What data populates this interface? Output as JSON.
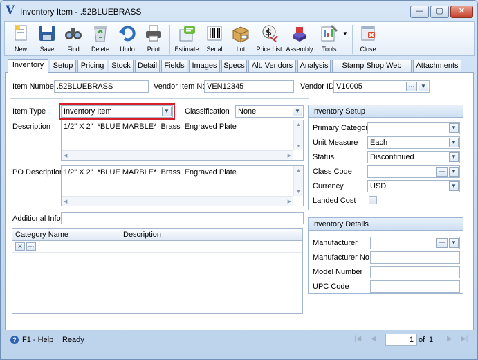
{
  "window": {
    "logo": "V",
    "title": "Inventory Item - .52BLUEBRASS",
    "controls": {
      "minimize": "—",
      "maximize": "▢",
      "close": "✕"
    }
  },
  "toolbar": {
    "buttons": [
      {
        "label": "New",
        "icon": "new-doc-icon"
      },
      {
        "label": "Save",
        "icon": "floppy-disk-icon"
      },
      {
        "label": "Find",
        "icon": "binoculars-icon"
      },
      {
        "label": "Delete",
        "icon": "recycle-bin-icon"
      },
      {
        "label": "Undo",
        "icon": "undo-arrow-icon"
      },
      {
        "label": "Print",
        "icon": "printer-icon"
      },
      {
        "label": "Estimate",
        "icon": "estimate-icon"
      },
      {
        "label": "Serial",
        "icon": "barcode-icon"
      },
      {
        "label": "Lot",
        "icon": "lot-box-icon"
      },
      {
        "label": "Price List",
        "icon": "price-list-icon"
      },
      {
        "label": "Assembly",
        "icon": "assembly-blocks-icon"
      },
      {
        "label": "Tools",
        "icon": "tools-icon"
      },
      {
        "label": "Close",
        "icon": "close-door-icon"
      }
    ]
  },
  "tabs": [
    "Inventory",
    "Setup",
    "Pricing",
    "Stock",
    "Detail",
    "Fields",
    "Images",
    "Specs",
    "Alt. Vendors",
    "Analysis",
    "Stamp Shop Web Detail",
    "Attachments"
  ],
  "header": {
    "item_number_label": "Item Number",
    "item_number": ".52BLUEBRASS",
    "vendor_item_label": "Vendor Item No",
    "vendor_item": "VEN12345",
    "vendor_id_label": "Vendor ID",
    "vendor_id": "V10005"
  },
  "main": {
    "item_type_label": "Item Type",
    "item_type": "Inventory Item",
    "classification_label": "Classification",
    "classification": "None",
    "description_label": "Description",
    "description": "1/2\" X 2\"  *BLUE MARBLE*  Brass  Engraved Plate",
    "po_description_label": "PO Description",
    "po_description": "1/2\" X 2\"  *BLUE MARBLE*  Brass  Engraved Plate",
    "additional_info_label": "Additional Info",
    "additional_info": ""
  },
  "category_grid": {
    "columns": [
      "Category Name",
      "Description"
    ]
  },
  "inventory_setup": {
    "title": "Inventory Setup",
    "primary_category_label": "Primary Category",
    "primary_category": "",
    "unit_measure_label": "Unit Measure",
    "unit_measure": "Each",
    "status_label": "Status",
    "status": "Discontinued",
    "class_code_label": "Class Code",
    "class_code": "",
    "currency_label": "Currency",
    "currency": "USD",
    "landed_cost_label": "Landed Cost"
  },
  "inventory_details": {
    "title": "Inventory Details",
    "manufacturer_label": "Manufacturer",
    "manufacturer_no_label": "Manufacturer No",
    "model_number_label": "Model Number",
    "upc_code_label": "UPC Code"
  },
  "status_bar": {
    "help": "F1 - Help",
    "status": "Ready",
    "page": "1",
    "of_label": "of",
    "total": "1"
  },
  "colors": {
    "highlight_border": "#d8202a",
    "accent": "#1c4f9a"
  }
}
